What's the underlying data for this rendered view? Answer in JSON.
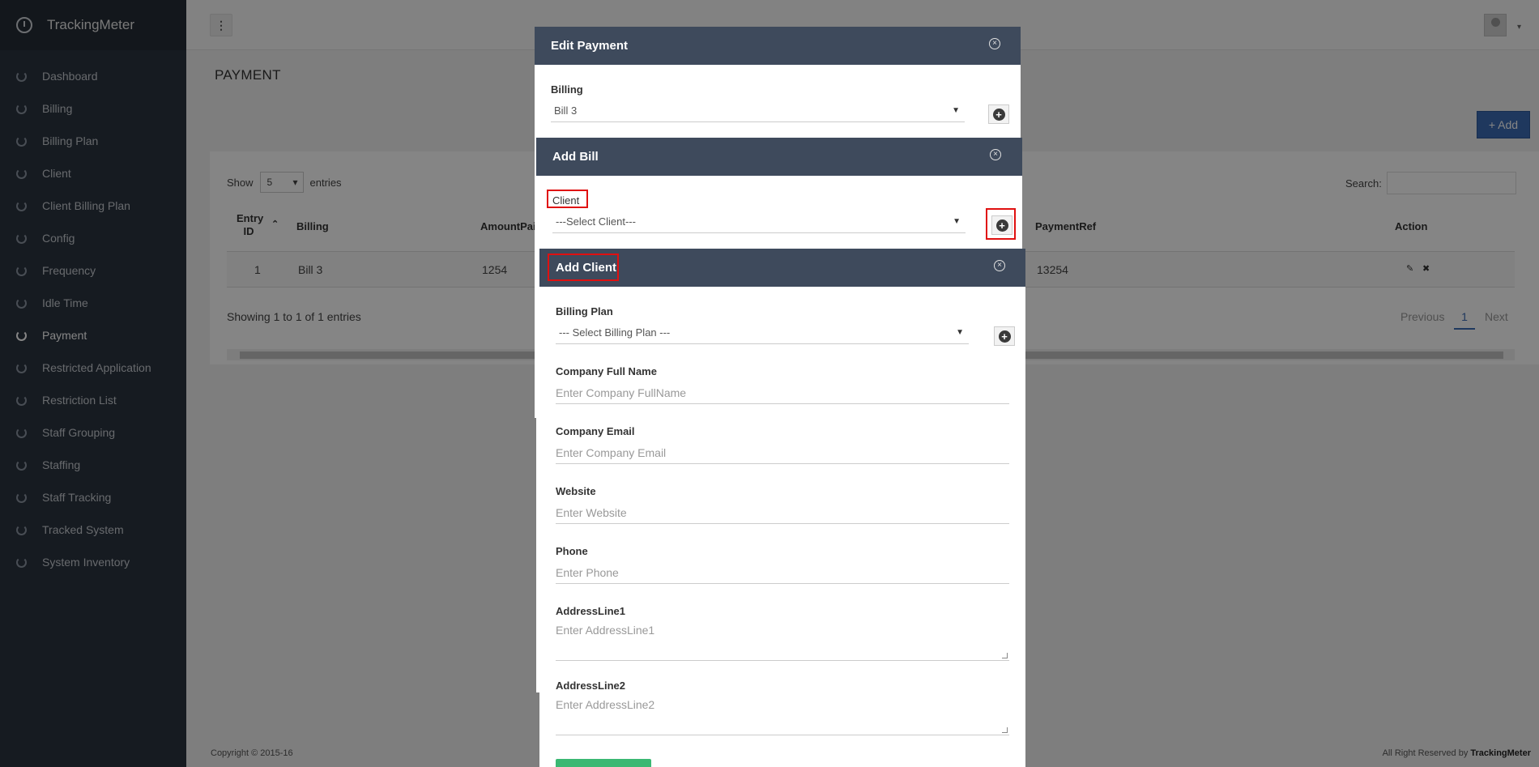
{
  "app": {
    "name": "TrackingMeter"
  },
  "sidebar": {
    "items": [
      {
        "label": "Dashboard",
        "active": false
      },
      {
        "label": "Billing",
        "active": false
      },
      {
        "label": "Billing Plan",
        "active": false
      },
      {
        "label": "Client",
        "active": false
      },
      {
        "label": "Client Billing Plan",
        "active": false
      },
      {
        "label": "Config",
        "active": false
      },
      {
        "label": "Frequency",
        "active": false
      },
      {
        "label": "Idle Time",
        "active": false
      },
      {
        "label": "Payment",
        "active": true
      },
      {
        "label": "Restricted Application",
        "active": false
      },
      {
        "label": "Restriction List",
        "active": false
      },
      {
        "label": "Staff Grouping",
        "active": false
      },
      {
        "label": "Staffing",
        "active": false
      },
      {
        "label": "Staff Tracking",
        "active": false
      },
      {
        "label": "Tracked System",
        "active": false
      },
      {
        "label": "System Inventory",
        "active": false
      }
    ]
  },
  "topbar": {
    "menu_glyph": "⋮",
    "caret": "▾"
  },
  "page": {
    "title": "PAYMENT",
    "add_label": "+ Add"
  },
  "table": {
    "show_label": "Show",
    "entries_value": "5",
    "entries_label": "entries",
    "search_label": "Search:",
    "headers": {
      "entry_id_1": "Entry",
      "entry_id_2": "ID",
      "billing": "Billing",
      "amount": "AmountPaid",
      "payment_ref": "PaymentRef",
      "action": "Action"
    },
    "rows": [
      {
        "id": "1",
        "billing": "Bill 3",
        "amount": "1254",
        "payment_ref": "13254"
      }
    ],
    "showing": "Showing 1 to 1 of 1 entries",
    "pager": {
      "previous": "Previous",
      "current": "1",
      "next": "Next"
    }
  },
  "footer": {
    "copyright": "Copyright © 2015-16",
    "rights_prefix": "All Right Reserved by ",
    "rights_brand": "TrackingMeter"
  },
  "edit_payment": {
    "title": "Edit Payment",
    "billing_label": "Billing",
    "billing_value": "Bill 3"
  },
  "add_bill": {
    "title": "Add Bill",
    "client_label": "Client",
    "client_value": "---Select Client---"
  },
  "add_client": {
    "title": "Add Client",
    "billing_plan_label": "Billing Plan",
    "billing_plan_value": "--- Select Billing Plan ---",
    "company_name_label": "Company Full Name",
    "company_name_placeholder": "Enter Company FullName",
    "company_email_label": "Company Email",
    "company_email_placeholder": "Enter Company Email",
    "website_label": "Website",
    "website_placeholder": "Enter Website",
    "phone_label": "Phone",
    "phone_placeholder": "Enter Phone",
    "address1_label": "AddressLine1",
    "address1_placeholder": "Enter AddressLine1",
    "address2_label": "AddressLine2",
    "address2_placeholder": "Enter AddressLine2"
  },
  "colors": {
    "sidebar_bg": "#2b3440",
    "modal_header": "#3e4a5c",
    "primary": "#3c6cb4",
    "highlight": "#e01010",
    "save_button": "#3bb873"
  }
}
